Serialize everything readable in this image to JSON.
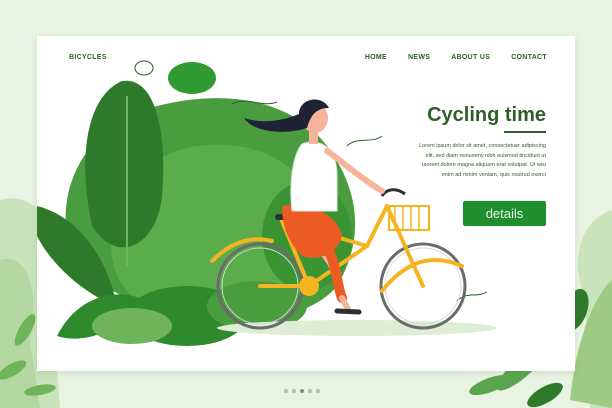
{
  "header": {
    "brand": "BICYCLES",
    "nav": [
      "HOME",
      "NEWS",
      "ABOUT US",
      "CONTACT"
    ]
  },
  "hero": {
    "title": "Cycling time",
    "lines": [
      "Lorem ipsum dolor sit amet, consectetuer adipiscing",
      "elit, sed diam nonummy nibh euismod tincidunt ut",
      "laoreet dolore magna aliquam erat volutpat. Ut wisi",
      "enim ad minim veniam, quis nostrud exerci"
    ],
    "button": "details"
  },
  "illustration": {
    "subject": "woman riding bicycle with basket",
    "colors": {
      "dark_green": "#2e5e2a",
      "mid_green": "#4a9d3f",
      "light_green": "#8ec96a",
      "bike_yellow": "#f4b521",
      "shorts_orange": "#ec5b24",
      "hair": "#1f2235",
      "skin": "#f5b59a"
    }
  },
  "pagination": {
    "count": 5,
    "active": 2
  }
}
